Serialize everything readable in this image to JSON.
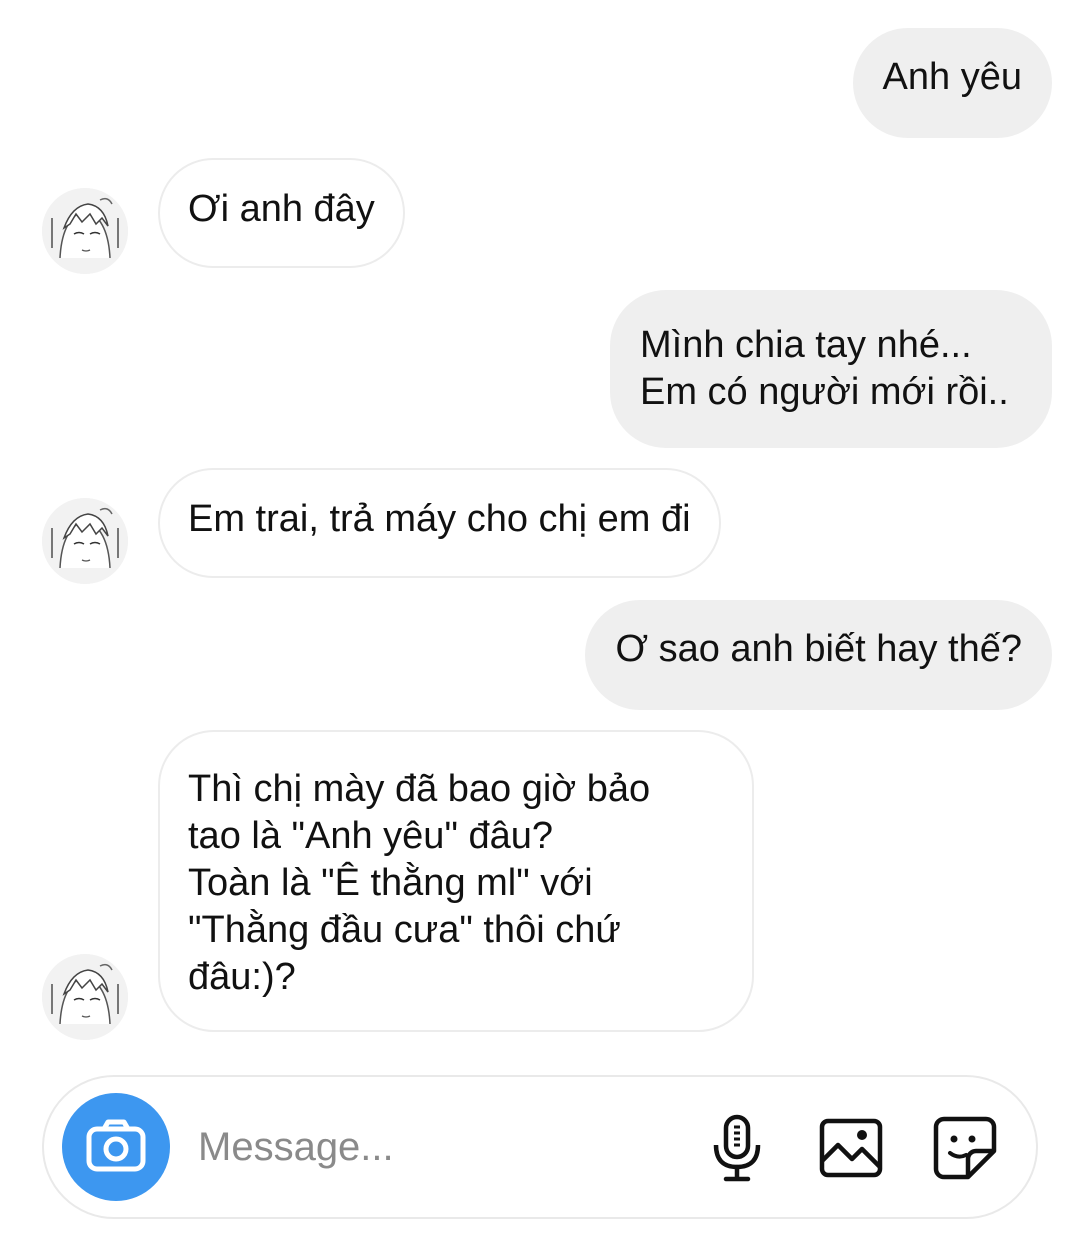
{
  "messages": [
    {
      "side": "sent",
      "text": "Anh yêu"
    },
    {
      "side": "received",
      "text": "Ơi anh đây"
    },
    {
      "side": "sent",
      "text": "Mình chia tay nhé...\nEm có người mới rồi.."
    },
    {
      "side": "received",
      "text": "Em trai, trả máy cho chị em đi"
    },
    {
      "side": "sent",
      "text": "Ơ sao anh biết hay thế?"
    },
    {
      "side": "received",
      "text": "Thì chị mày đã bao giờ bảo\ntao là \"Anh yêu\" đâu?\nToàn là \"Ê thằng ml\" với\n\"Thằng đầu cưa\" thôi chứ\nđâu:)?"
    }
  ],
  "composer": {
    "placeholder": "Message...",
    "camera_icon": "camera-icon",
    "mic_icon": "microphone-icon",
    "gallery_icon": "image-icon",
    "sticker_icon": "sticker-icon"
  },
  "colors": {
    "sent_bubble": "#efefef",
    "received_border": "#ececec",
    "camera_button": "#3d97f0"
  }
}
